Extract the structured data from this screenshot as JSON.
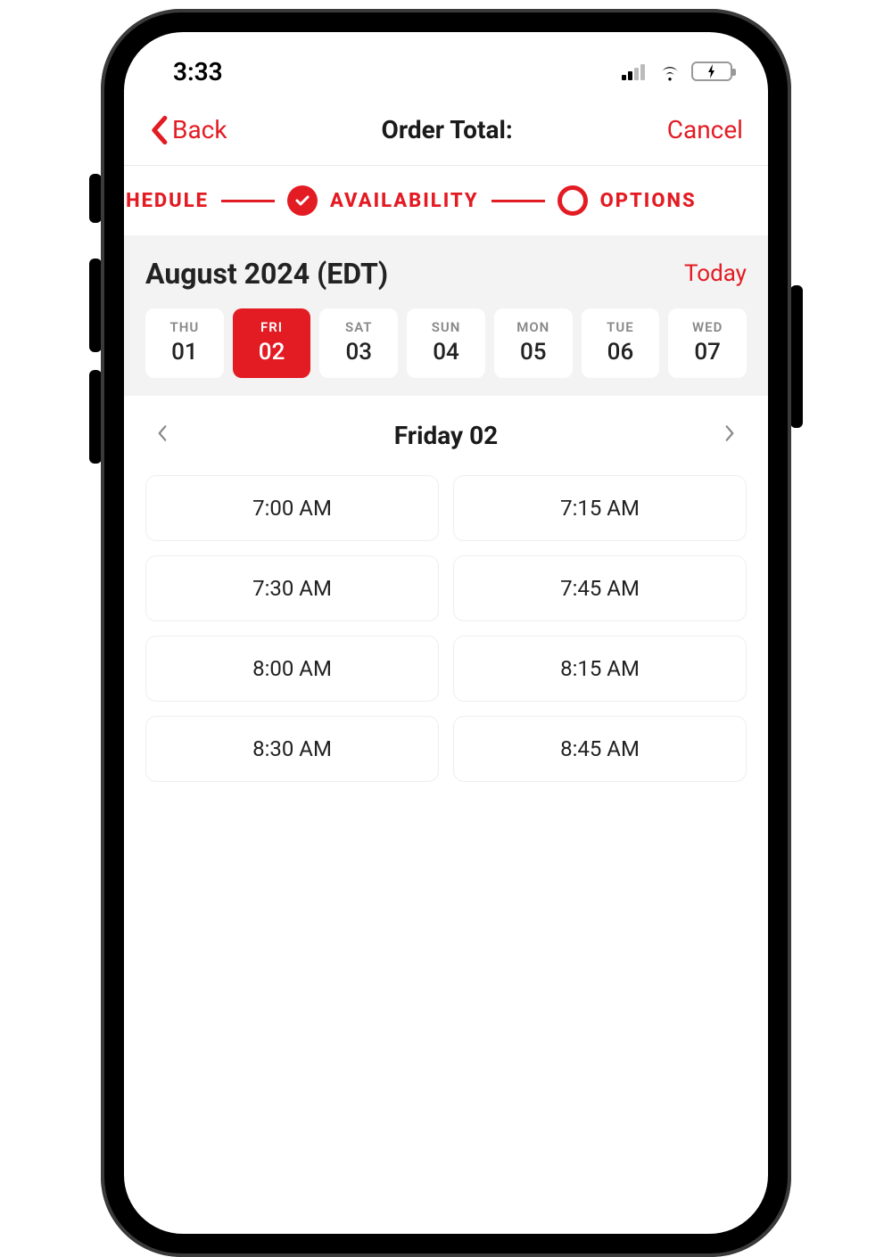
{
  "status": {
    "time": "3:33"
  },
  "nav": {
    "back": "Back",
    "title": "Order Total:",
    "cancel": "Cancel"
  },
  "stepper": {
    "step1": "SCHEDULE",
    "step2": "AVAILABILITY",
    "step3": "OPTIONS"
  },
  "calendar": {
    "title": "August 2024 (EDT)",
    "today": "Today",
    "days": [
      {
        "dow": "THU",
        "num": "01",
        "selected": false
      },
      {
        "dow": "FRI",
        "num": "02",
        "selected": true
      },
      {
        "dow": "SAT",
        "num": "03",
        "selected": false
      },
      {
        "dow": "SUN",
        "num": "04",
        "selected": false
      },
      {
        "dow": "MON",
        "num": "05",
        "selected": false
      },
      {
        "dow": "TUE",
        "num": "06",
        "selected": false
      },
      {
        "dow": "WED",
        "num": "07",
        "selected": false
      }
    ]
  },
  "dayNav": {
    "title": "Friday 02"
  },
  "slots": [
    "7:00 AM",
    "7:15 AM",
    "7:30 AM",
    "7:45 AM",
    "8:00 AM",
    "8:15 AM",
    "8:30 AM",
    "8:45 AM"
  ],
  "colors": {
    "accent": "#e31b23"
  }
}
